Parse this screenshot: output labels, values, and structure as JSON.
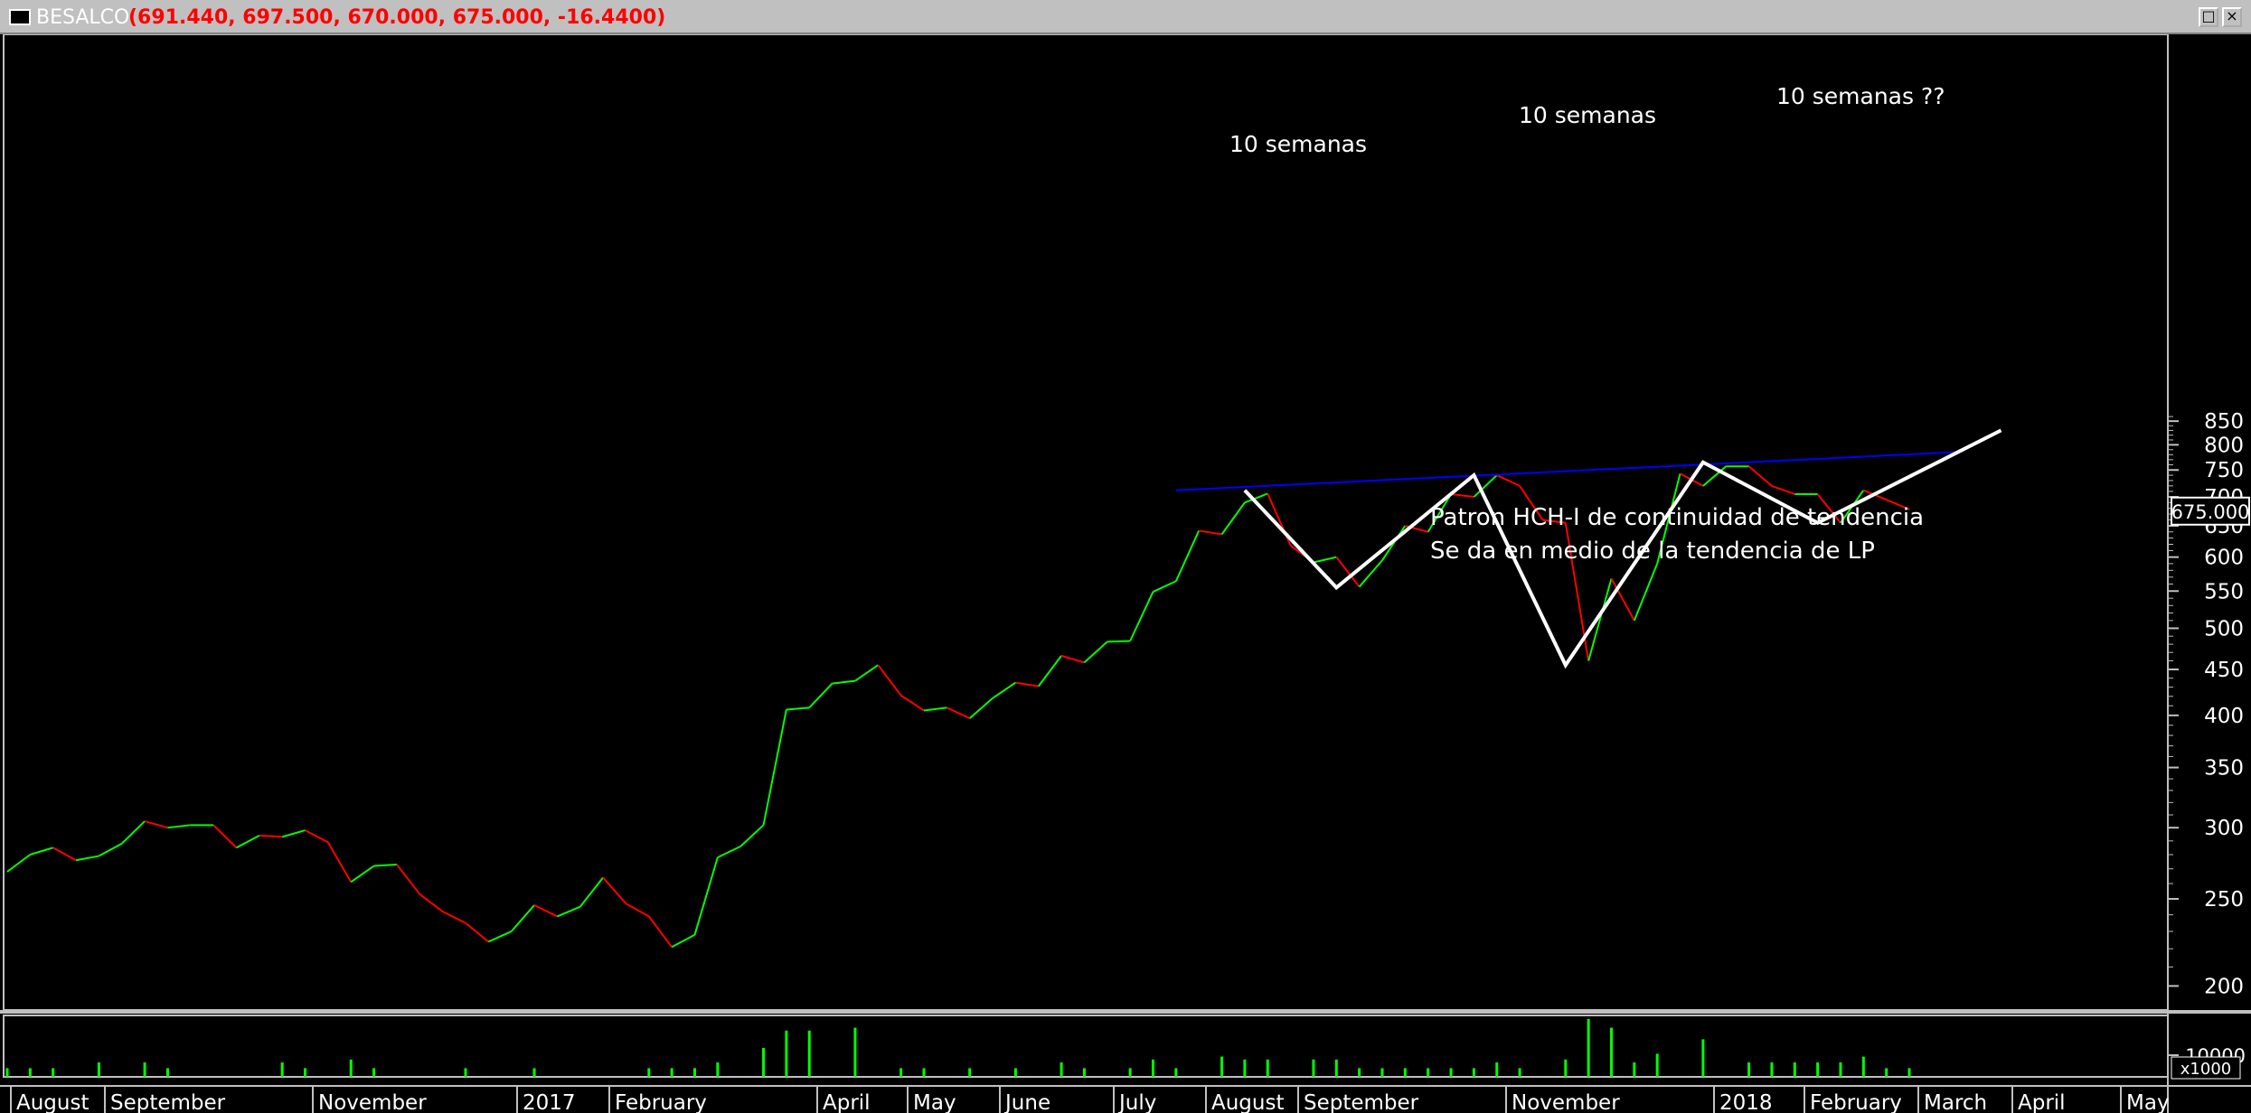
{
  "window": {
    "title": "BESALCO",
    "quote": "(691.440, 697.500, 670.000, 675.000, -16.4400)",
    "restore_icon": "restore-icon",
    "close_icon": "close-icon"
  },
  "colors": {
    "up": "#00ff00",
    "down": "#ff0000",
    "pattern": "#ffffff",
    "trendline": "#0000ff",
    "volume": "#00ff00",
    "axis_text": "#ffffff",
    "frame": "#c0c0c0"
  },
  "chart_data": {
    "type": "line",
    "price_axis": {
      "scale": "log",
      "ticks": [
        200,
        250,
        300,
        350,
        400,
        450,
        500,
        550,
        600,
        650,
        700,
        750,
        800,
        850
      ],
      "last_value_label": "675.000"
    },
    "x_labels": [
      "August",
      "September",
      "November",
      "2017",
      "February",
      "April",
      "May",
      "June",
      "July",
      "August",
      "September",
      "November",
      "2018",
      "February",
      "March",
      "April",
      "May"
    ],
    "weekly_close": [
      268,
      280,
      285,
      276,
      279,
      288,
      305,
      300,
      302,
      302,
      285,
      294,
      293,
      298,
      289,
      261,
      272,
      273,
      253,
      242,
      235,
      224,
      230,
      246,
      239,
      245,
      264,
      247,
      239,
      221,
      228,
      278,
      286,
      302,
      406,
      408,
      434,
      437,
      455,
      421,
      405,
      408,
      397,
      418,
      435,
      431,
      466,
      458,
      483,
      484,
      549,
      564,
      642,
      636,
      690,
      706,
      618,
      592,
      600,
      556,
      595,
      650,
      640,
      705,
      700,
      740,
      720,
      660,
      655,
      460,
      568,
      510,
      590,
      743,
      720,
      757,
      757,
      720,
      705,
      705,
      655,
      712,
      695,
      678
    ],
    "pattern_line": [
      {
        "week": 54,
        "price": 712
      },
      {
        "week": 58,
        "price": 555
      },
      {
        "week": 64,
        "price": 740
      },
      {
        "week": 68,
        "price": 455
      },
      {
        "week": 74,
        "price": 765
      },
      {
        "week": 79,
        "price": 655
      },
      {
        "week": 87,
        "price": 830
      }
    ],
    "trendline": [
      {
        "week": 51,
        "price": 712
      },
      {
        "week": 85,
        "price": 785
      }
    ],
    "annotations": [
      "10 semanas",
      "10 semanas",
      "10 semanas ??",
      "Patron HCH-I de continuidad de tendencia",
      "Se da en medio de la tendencia de LP"
    ],
    "volume_axis": {
      "label": "10000",
      "multiplier": "x1000"
    },
    "volume": [
      3,
      3,
      3,
      0,
      5,
      0,
      5,
      3,
      0,
      0,
      0,
      0,
      5,
      3,
      0,
      6,
      3,
      0,
      0,
      0,
      3,
      0,
      0,
      3,
      0,
      0,
      0,
      0,
      3,
      3,
      3,
      5,
      0,
      10,
      16,
      16,
      0,
      17,
      0,
      3,
      3,
      0,
      3,
      0,
      3,
      0,
      5,
      3,
      0,
      3,
      6,
      3,
      0,
      7,
      6,
      6,
      0,
      6,
      6,
      3,
      3,
      3,
      3,
      3,
      3,
      5,
      3,
      0,
      6,
      20,
      17,
      5,
      8,
      0,
      13,
      0,
      5,
      5,
      5,
      5,
      5,
      7,
      3,
      3
    ]
  }
}
